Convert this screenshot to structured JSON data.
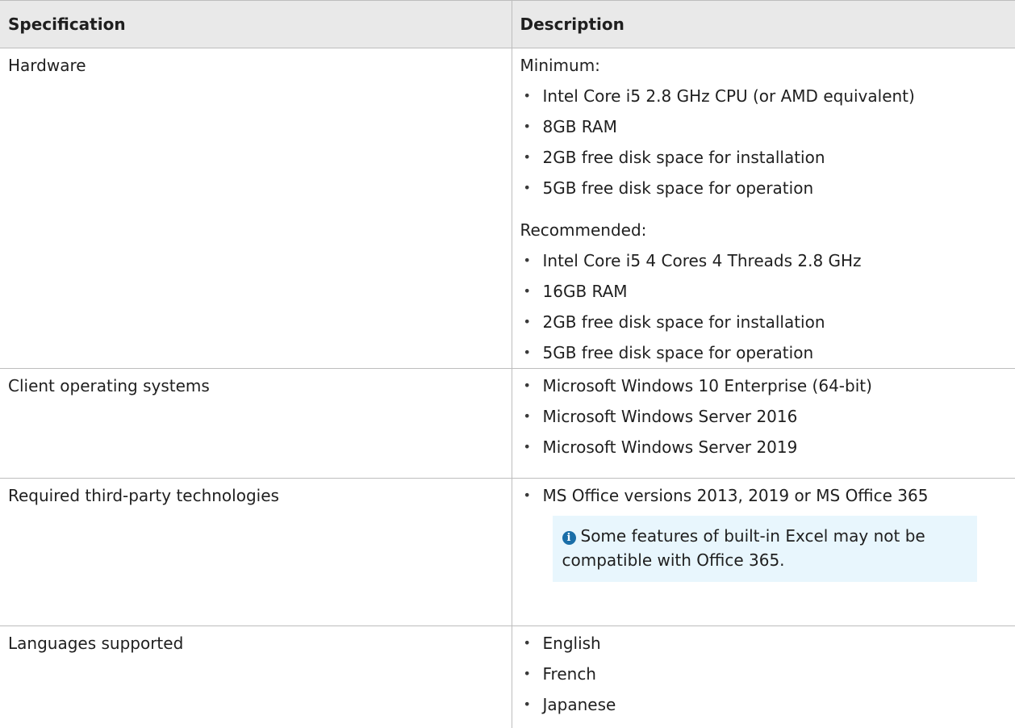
{
  "table": {
    "headers": [
      "Specification",
      "Description"
    ],
    "rows": [
      {
        "spec": "Hardware",
        "minimum_label": "Minimum:",
        "minimum_items": [
          "Intel Core i5 2.8 GHz CPU (or AMD equivalent)",
          "8GB RAM",
          "2GB free disk space for installation",
          "5GB free disk space for operation"
        ],
        "recommended_label": "Recommended:",
        "recommended_items": [
          "Intel Core i5 4 Cores 4 Threads 2.8 GHz",
          "16GB RAM",
          "2GB free disk space for installation",
          "5GB free disk space for operation"
        ]
      },
      {
        "spec": "Client operating systems",
        "items": [
          "Microsoft Windows 10 Enterprise (64-bit)",
          "Microsoft Windows Server 2016",
          "Microsoft Windows Server 2019"
        ]
      },
      {
        "spec": "Required third-party technologies",
        "items": [
          "MS Office versions 2013, 2019 or MS Office 365"
        ],
        "note_icon": "info-icon",
        "note_symbol": "i",
        "note_text": "Some features of built-in Excel may not be compatible with Office 365."
      },
      {
        "spec": "Languages supported",
        "items": [
          "English",
          "French",
          "Japanese"
        ]
      }
    ]
  },
  "colors": {
    "header_bg": "#e9e9e9",
    "note_bg": "#e8f6fd",
    "info_icon": "#1a6ea8",
    "border": "#bdbdbd"
  },
  "bullet_glyph": "•"
}
